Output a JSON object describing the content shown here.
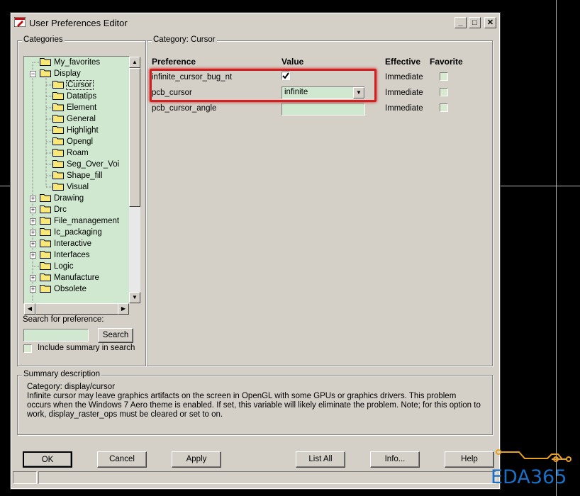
{
  "window": {
    "title": "User Preferences Editor"
  },
  "title_buttons": {
    "minimize": "_",
    "maximize": "□",
    "close": "✕"
  },
  "categories": {
    "label": "Categories",
    "items": [
      {
        "label": "My_favorites",
        "level": 0,
        "expander": ""
      },
      {
        "label": "Display",
        "level": 0,
        "expander": "−"
      },
      {
        "label": "Cursor",
        "level": 1,
        "expander": "",
        "selected": true
      },
      {
        "label": "Datatips",
        "level": 1,
        "expander": ""
      },
      {
        "label": "Element",
        "level": 1,
        "expander": ""
      },
      {
        "label": "General",
        "level": 1,
        "expander": ""
      },
      {
        "label": "Highlight",
        "level": 1,
        "expander": ""
      },
      {
        "label": "Opengl",
        "level": 1,
        "expander": ""
      },
      {
        "label": "Roam",
        "level": 1,
        "expander": ""
      },
      {
        "label": "Seg_Over_Voi",
        "level": 1,
        "expander": ""
      },
      {
        "label": "Shape_fill",
        "level": 1,
        "expander": ""
      },
      {
        "label": "Visual",
        "level": 1,
        "expander": ""
      },
      {
        "label": "Drawing",
        "level": 0,
        "expander": "+"
      },
      {
        "label": "Drc",
        "level": 0,
        "expander": "+"
      },
      {
        "label": "File_management",
        "level": 0,
        "expander": "+"
      },
      {
        "label": "Ic_packaging",
        "level": 0,
        "expander": "+"
      },
      {
        "label": "Interactive",
        "level": 0,
        "expander": "+"
      },
      {
        "label": "Interfaces",
        "level": 0,
        "expander": "+"
      },
      {
        "label": "Logic",
        "level": 0,
        "expander": ""
      },
      {
        "label": "Manufacture",
        "level": 0,
        "expander": "+"
      },
      {
        "label": "Obsolete",
        "level": 0,
        "expander": "+"
      }
    ]
  },
  "search": {
    "label": "Search for preference:",
    "value": "",
    "button": "Search",
    "include_summary_label": "Include summary in search",
    "include_summary_checked": false
  },
  "category_panel": {
    "label": "Category:  Cursor",
    "headers": {
      "preference": "Preference",
      "value": "Value",
      "effective": "Effective",
      "favorite": "Favorite"
    },
    "rows": [
      {
        "preference": "infinite_cursor_bug_nt",
        "value_type": "checkbox",
        "checked": true,
        "effective": "Immediate",
        "favorite": false
      },
      {
        "preference": "pcb_cursor",
        "value_type": "dropdown",
        "value": "infinite",
        "effective": "Immediate",
        "favorite": false
      },
      {
        "preference": "pcb_cursor_angle",
        "value_type": "text",
        "value": "",
        "effective": "Immediate",
        "favorite": false
      }
    ]
  },
  "summary": {
    "label": "Summary description",
    "category_line": "Category: display/cursor",
    "text": "Infinite cursor may leave graphics artifacts on the screen in OpenGL with some GPUs or graphics drivers. This problem occurs when the Windows 7 Aero theme is enabled. If set, this variable will likely eliminate the problem. Note; for this option to work, display_raster_ops must be cleared or set to on."
  },
  "buttons": {
    "ok": "OK",
    "cancel": "Cancel",
    "apply": "Apply",
    "list_all": "List All",
    "info": "Info...",
    "help": "Help"
  },
  "watermark": {
    "text": "EDA365"
  },
  "colors": {
    "field_green": "#cfe8cf",
    "dialog_gray": "#d4d0c8",
    "highlight_red": "#d02020",
    "logo_blue": "#1a6fc4"
  }
}
